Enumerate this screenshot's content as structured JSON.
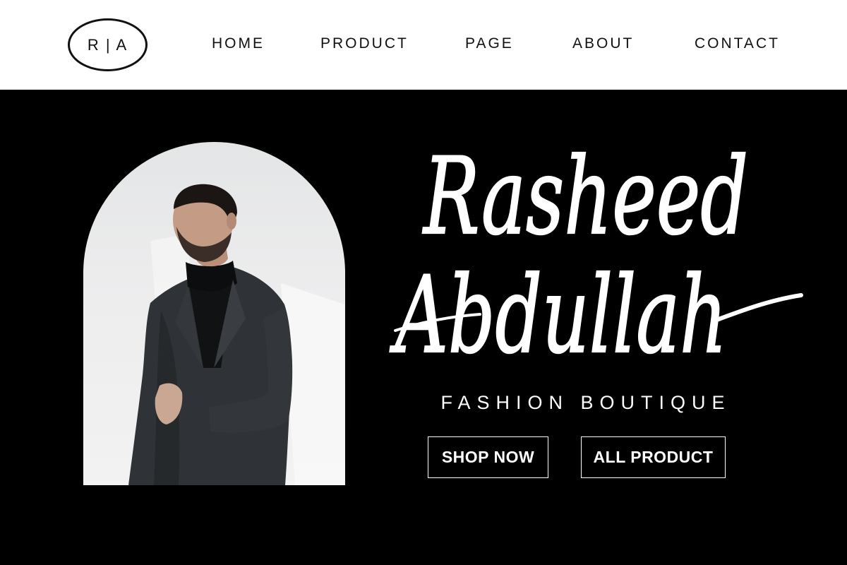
{
  "header": {
    "logo_text": "R | A",
    "nav": [
      {
        "label": "HOME"
      },
      {
        "label": "PRODUCT"
      },
      {
        "label": "PAGE"
      },
      {
        "label": "ABOUT"
      },
      {
        "label": "CONTACT"
      }
    ]
  },
  "hero": {
    "name_line1": "Rasheed",
    "name_line2": "Abdullah",
    "tagline": "FASHION BOUTIQUE",
    "buttons": {
      "shop_now": "SHOP NOW",
      "all_product": "ALL PRODUCT"
    }
  },
  "colors": {
    "header_bg": "#ffffff",
    "hero_bg": "#000000",
    "text_light": "#ffffff",
    "text_dark": "#111111"
  }
}
